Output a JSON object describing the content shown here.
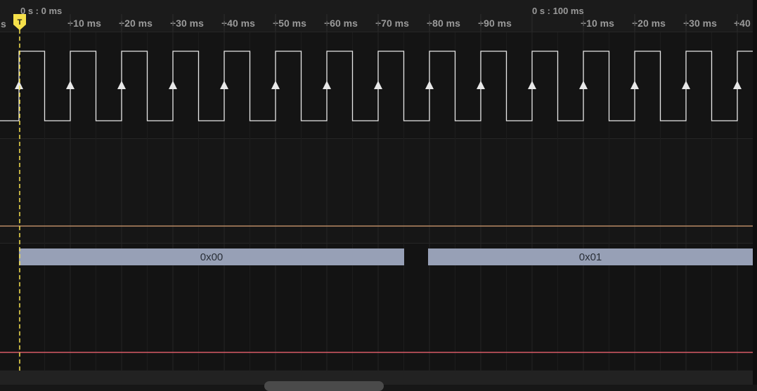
{
  "ruler": {
    "left_edge_label": "s",
    "origin_label": "0 s : 0 ms",
    "mid_origin_label": "0 s : 100 ms",
    "ticks": [
      "+10 ms",
      "+20 ms",
      "+30 ms",
      "+40 ms",
      "+50 ms",
      "+60 ms",
      "+70 ms",
      "+80 ms",
      "+90 ms",
      "+10 ms",
      "+20 ms",
      "+30 ms",
      "+40"
    ]
  },
  "trigger": {
    "label": "T",
    "color": "#f5e04a"
  },
  "colors": {
    "clock_trace": "#e8e8e8",
    "channel_orange": "#b98a63",
    "channel_red": "#d85a66",
    "packet_fill": "#97a0b6"
  },
  "lanes": {
    "clock": {
      "edge_marker": "rising-edge-arrow"
    },
    "packets": [
      {
        "value": "0x00"
      },
      {
        "value": "0x01"
      }
    ]
  }
}
